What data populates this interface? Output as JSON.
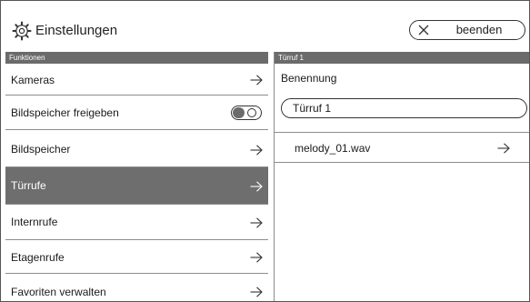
{
  "app": {
    "title": "Einstellungen"
  },
  "header": {
    "quit_label": "beenden"
  },
  "left_panel": {
    "section_title": "Funktionen",
    "items": [
      {
        "label": "Kameras",
        "control": "arrow",
        "active": false
      },
      {
        "label": "Bildspeicher freigeben",
        "control": "toggle",
        "toggle_state": "off",
        "active": false
      },
      {
        "label": "Bildspeicher",
        "control": "arrow",
        "active": false
      },
      {
        "label": "Türrufe",
        "control": "arrow",
        "active": true
      },
      {
        "label": "Internrufe",
        "control": "arrow",
        "active": false
      },
      {
        "label": "Etagenrufe",
        "control": "arrow",
        "active": false
      },
      {
        "label": "Favoriten verwalten",
        "control": "arrow",
        "active": false
      }
    ]
  },
  "right_panel": {
    "section_title": "Türruf 1",
    "name_label": "Benennung",
    "name_value": "Türruf 1",
    "melody": {
      "label": "melody_01.wav"
    }
  },
  "colors": {
    "section_bar": "#6b6b6b",
    "active_row": "#6e6e6e",
    "border": "#333333"
  },
  "icons": {
    "settings": "gear-icon",
    "quit": "close-icon",
    "navigate": "arrow-right-icon"
  }
}
